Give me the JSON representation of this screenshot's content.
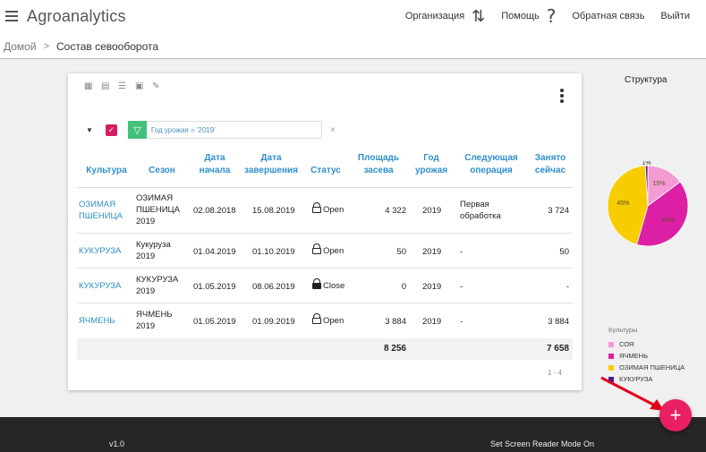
{
  "header": {
    "app_title": "Agroanalytics",
    "nav": [
      {
        "label": "Организация",
        "icon": "sync-arrows-icon"
      },
      {
        "label": "Помощь",
        "icon": "question-icon"
      },
      {
        "label": "Обратная связь"
      },
      {
        "label": "Выйти"
      }
    ]
  },
  "breadcrumb": {
    "home": "Домой",
    "current": "Состав севооборота"
  },
  "filter": {
    "value": "Год урожая = '2019'",
    "clear": "×"
  },
  "table": {
    "columns": [
      {
        "key": "culture",
        "label": "Культура"
      },
      {
        "key": "season",
        "label": "Сезон"
      },
      {
        "key": "start",
        "label": "Дата начала"
      },
      {
        "key": "end",
        "label": "Дата завершения"
      },
      {
        "key": "status",
        "label": "Статус"
      },
      {
        "key": "area",
        "label": "Площадь засева"
      },
      {
        "key": "year",
        "label": "Год урожая"
      },
      {
        "key": "next",
        "label": "Следующая операция"
      },
      {
        "key": "busy",
        "label": "Занято сейчас"
      }
    ],
    "rows": [
      {
        "culture": "ОЗИМАЯ ПШЕНИЦА",
        "season": "ОЗИМАЯ ПШЕНИЦА 2019",
        "start": "02.08.2018",
        "end": "15.08.2019",
        "status": "Open",
        "area": "4 322",
        "year": "2019",
        "next": "Первая обработка",
        "busy": "3 724"
      },
      {
        "culture": "КУКУРУЗА",
        "season": "Кукуруза 2019",
        "start": "01.04.2019",
        "end": "01.10.2019",
        "status": "Open",
        "area": "50",
        "year": "2019",
        "next": "-",
        "busy": "50"
      },
      {
        "culture": "КУКУРУЗА",
        "season": "КУКУРУЗА 2019",
        "start": "01.05.2019",
        "end": "08.06.2019",
        "status": "Close",
        "area": "0",
        "year": "2019",
        "next": "-",
        "busy": "-"
      },
      {
        "culture": "ЯЧМЕНЬ",
        "season": "ЯЧМЕНЬ 2019",
        "start": "01.05.2019",
        "end": "01.09.2019",
        "status": "Open",
        "area": "3 884",
        "year": "2019",
        "next": "-",
        "busy": "3 884"
      }
    ],
    "totals": {
      "area": "8 256",
      "busy": "7 658"
    },
    "pager": "1 - 4"
  },
  "structure": {
    "title": "Структура",
    "legend_title": "Культуры"
  },
  "chart_data": {
    "type": "pie",
    "title": "Структура",
    "series": [
      {
        "name": "СОЯ",
        "value": 15,
        "label": "15%",
        "color": "#f59bd3"
      },
      {
        "name": "ЯЧМЕНЬ",
        "value": 40,
        "label": "40%",
        "color": "#dd1fa6"
      },
      {
        "name": "ОЗИМАЯ ПШЕНИЦА",
        "value": 45,
        "label": "45%",
        "color": "#f7cd00"
      },
      {
        "name": "КУКУРУЗА",
        "value": 1,
        "label": "1%",
        "color": "#4a1f8c"
      }
    ],
    "legend_position": "bottom"
  },
  "fab": {
    "label": "+"
  },
  "footer": {
    "version": "v1.0",
    "screen_reader": "Set Screen Reader Mode On"
  }
}
